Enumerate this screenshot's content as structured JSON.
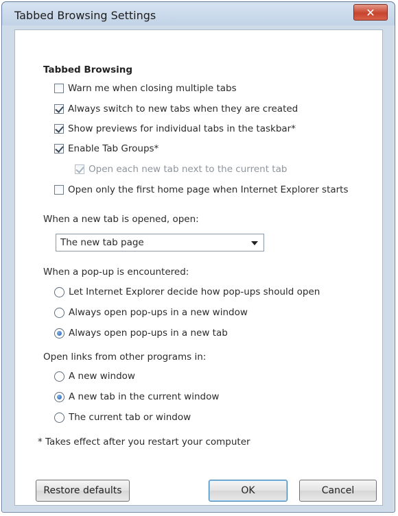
{
  "window": {
    "title": "Tabbed Browsing Settings",
    "close_glyph": "✕"
  },
  "tabbed_browsing": {
    "heading": "Tabbed Browsing",
    "options": [
      {
        "label": "Warn me when closing multiple tabs",
        "checked": false
      },
      {
        "label": "Always switch to new tabs when they are created",
        "checked": true
      },
      {
        "label": "Show previews for individual tabs in the taskbar*",
        "checked": true
      },
      {
        "label": "Enable Tab Groups*",
        "checked": true
      },
      {
        "label": "Open each new tab next to the current tab",
        "checked": true,
        "disabled": true
      },
      {
        "label": "Open only the first home page when Internet Explorer starts",
        "checked": false
      }
    ]
  },
  "new_tab": {
    "label": "When a new tab is opened, open:",
    "selected": "The new tab page"
  },
  "popups": {
    "label": "When a pop-up is encountered:",
    "options": [
      {
        "label": "Let Internet Explorer decide how pop-ups should open",
        "selected": false
      },
      {
        "label": "Always open pop-ups in a new window",
        "selected": false
      },
      {
        "label": "Always open pop-ups in a new tab",
        "selected": true
      }
    ]
  },
  "open_links": {
    "label": "Open links from other programs in:",
    "options": [
      {
        "label": "A new window",
        "selected": false
      },
      {
        "label": "A new tab in the current window",
        "selected": true
      },
      {
        "label": "The current tab or window",
        "selected": false
      }
    ]
  },
  "footnote": "* Takes effect after you restart your computer",
  "buttons": {
    "restore": "Restore defaults",
    "ok": "OK",
    "cancel": "Cancel"
  }
}
